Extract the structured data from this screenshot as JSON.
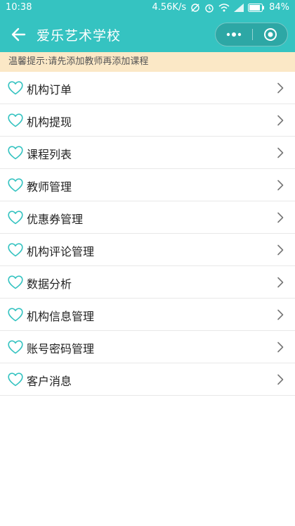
{
  "status_bar": {
    "time": "10:38",
    "net_speed": "4.56K/s",
    "battery": "84%"
  },
  "navbar": {
    "title": "爱乐艺术学校"
  },
  "tip": {
    "text": "温馨提示:请先添加教师再添加课程"
  },
  "menu": {
    "items": [
      {
        "label": "机构订单"
      },
      {
        "label": "机构提现"
      },
      {
        "label": "课程列表"
      },
      {
        "label": "教师管理"
      },
      {
        "label": "优惠券管理"
      },
      {
        "label": "机构评论管理"
      },
      {
        "label": "数据分析"
      },
      {
        "label": "机构信息管理"
      },
      {
        "label": "账号密码管理"
      },
      {
        "label": "客户消息"
      }
    ]
  },
  "colors": {
    "header_bg": "#35c3c1",
    "tip_bg": "#fbe8c6",
    "heart_icon": "#35c3c1"
  },
  "icons": [
    "arrow-left-icon",
    "more-dots-icon",
    "record-circle-icon",
    "heart-outline-icon",
    "chevron-right-icon"
  ]
}
